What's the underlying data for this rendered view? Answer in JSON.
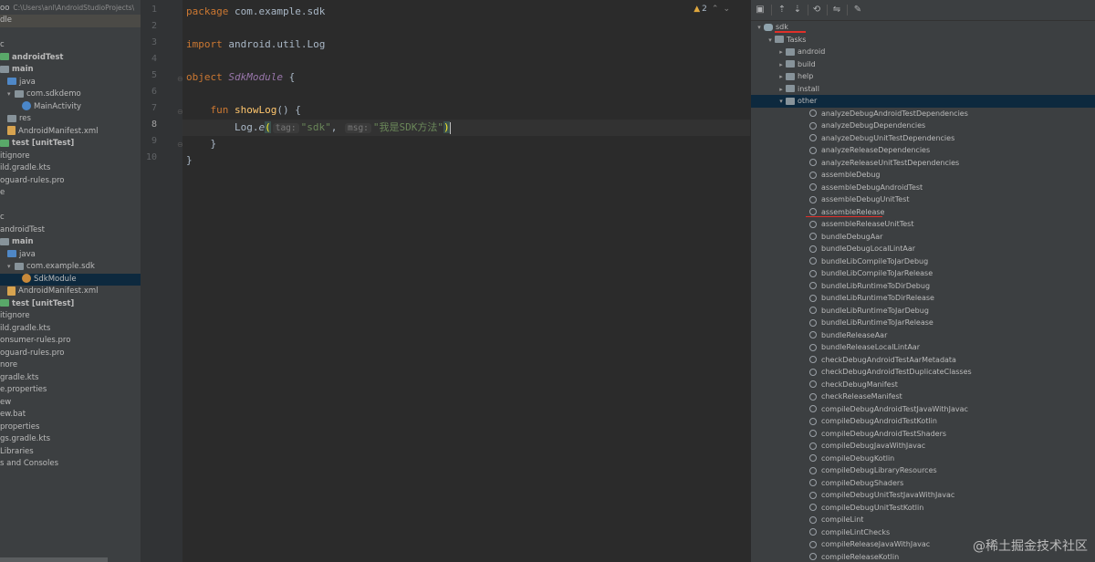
{
  "project_panel": {
    "header": {
      "name": "oo",
      "path": "C:\\Users\\anl\\AndroidStudioProjects\\"
    },
    "rows": [
      {
        "text": "dle",
        "indent": 0,
        "icon": "",
        "bold": false,
        "arrow": ""
      },
      {
        "text": "",
        "indent": 0,
        "icon": "",
        "bold": false,
        "arrow": ""
      },
      {
        "text": "c",
        "indent": 0,
        "icon": "",
        "bold": false,
        "arrow": ""
      },
      {
        "text": "androidTest",
        "indent": 0,
        "icon": "folder-green",
        "bold": true,
        "arrow": ""
      },
      {
        "text": "main",
        "indent": 0,
        "icon": "folder",
        "bold": true,
        "arrow": ""
      },
      {
        "text": "java",
        "indent": 1,
        "icon": "folder-blue",
        "bold": false,
        "arrow": ""
      },
      {
        "text": "com.sdkdemo",
        "indent": 1,
        "icon": "folder",
        "bold": false,
        "arrow": "down"
      },
      {
        "text": "MainActivity",
        "indent": 3,
        "icon": "kotlin",
        "bold": false,
        "arrow": ""
      },
      {
        "text": "res",
        "indent": 1,
        "icon": "folder",
        "bold": false,
        "arrow": ""
      },
      {
        "text": "AndroidManifest.xml",
        "indent": 1,
        "icon": "xml",
        "bold": false,
        "arrow": ""
      },
      {
        "text": "test [unitTest]",
        "indent": 0,
        "icon": "folder-green",
        "bold": true,
        "arrow": ""
      },
      {
        "text": "itignore",
        "indent": 0,
        "icon": "",
        "bold": false,
        "arrow": ""
      },
      {
        "text": "ild.gradle.kts",
        "indent": 0,
        "icon": "",
        "bold": false,
        "arrow": ""
      },
      {
        "text": "oguard-rules.pro",
        "indent": 0,
        "icon": "",
        "bold": false,
        "arrow": ""
      },
      {
        "text": "e",
        "indent": 0,
        "icon": "",
        "bold": false,
        "arrow": ""
      },
      {
        "text": "",
        "indent": 0,
        "icon": "",
        "bold": false,
        "arrow": ""
      },
      {
        "text": "c",
        "indent": 0,
        "icon": "",
        "bold": false,
        "arrow": ""
      },
      {
        "text": "androidTest",
        "indent": 0,
        "icon": "",
        "bold": false,
        "arrow": ""
      },
      {
        "text": "main",
        "indent": 0,
        "icon": "folder",
        "bold": true,
        "arrow": ""
      },
      {
        "text": "java",
        "indent": 1,
        "icon": "folder-blue",
        "bold": false,
        "arrow": ""
      },
      {
        "text": "com.example.sdk",
        "indent": 1,
        "icon": "folder",
        "bold": false,
        "arrow": "down"
      },
      {
        "text": "SdkModule",
        "indent": 3,
        "icon": "kotlin-orange",
        "bold": false,
        "arrow": ""
      },
      {
        "text": "AndroidManifest.xml",
        "indent": 1,
        "icon": "xml",
        "bold": false,
        "arrow": ""
      },
      {
        "text": "test [unitTest]",
        "indent": 0,
        "icon": "folder-green",
        "bold": true,
        "arrow": ""
      },
      {
        "text": "itignore",
        "indent": 0,
        "icon": "",
        "bold": false,
        "arrow": ""
      },
      {
        "text": "ild.gradle.kts",
        "indent": 0,
        "icon": "",
        "bold": false,
        "arrow": ""
      },
      {
        "text": "onsumer-rules.pro",
        "indent": 0,
        "icon": "",
        "bold": false,
        "arrow": ""
      },
      {
        "text": "oguard-rules.pro",
        "indent": 0,
        "icon": "",
        "bold": false,
        "arrow": ""
      },
      {
        "text": "nore",
        "indent": 0,
        "icon": "",
        "bold": false,
        "arrow": ""
      },
      {
        "text": "gradle.kts",
        "indent": 0,
        "icon": "",
        "bold": false,
        "arrow": ""
      },
      {
        "text": "e.properties",
        "indent": 0,
        "icon": "",
        "bold": false,
        "arrow": ""
      },
      {
        "text": "ew",
        "indent": 0,
        "icon": "",
        "bold": false,
        "arrow": ""
      },
      {
        "text": "ew.bat",
        "indent": 0,
        "icon": "",
        "bold": false,
        "arrow": ""
      },
      {
        "text": "properties",
        "indent": 0,
        "icon": "",
        "bold": false,
        "arrow": ""
      },
      {
        "text": "gs.gradle.kts",
        "indent": 0,
        "icon": "",
        "bold": false,
        "arrow": ""
      },
      {
        "text": "Libraries",
        "indent": 0,
        "icon": "",
        "bold": false,
        "arrow": ""
      },
      {
        "text": "s and Consoles",
        "indent": 0,
        "icon": "",
        "bold": false,
        "arrow": ""
      }
    ],
    "selected_index": 21
  },
  "editor": {
    "line_numbers": [
      "1",
      "2",
      "3",
      "4",
      "5",
      "6",
      "7",
      "8",
      "9",
      "10"
    ],
    "current_line": 8,
    "warning_count": "2",
    "lines": {
      "l1_kw": "package",
      "l1_rest": " com.example.sdk",
      "l3_kw": "import",
      "l3_rest": " android.util.Log",
      "l5_kw": "object",
      "l5_name": " SdkModule",
      "l5_rest": " {",
      "l7_indent": "    ",
      "l7_kw": "fun",
      "l7_name": " showLog",
      "l7_rest": "() {",
      "l8_indent": "        ",
      "l8_obj": "Log.",
      "l8_fn": "e",
      "l8_paren": "(",
      "l8_hint1": "tag:",
      "l8_str1": "\"sdk\"",
      "l8_comma": ",",
      "l8_hint2": "msg:",
      "l8_str2": "\"我是SDK方法\"",
      "l8_close": ")",
      "l9": "    }",
      "l10": "}"
    }
  },
  "gradle": {
    "rows": [
      {
        "text": "sdk",
        "level": 1,
        "type": "elephant",
        "arrow": "down"
      },
      {
        "text": "Tasks",
        "level": 2,
        "type": "folder",
        "arrow": "down"
      },
      {
        "text": "android",
        "level": 3,
        "type": "folder",
        "arrow": "right"
      },
      {
        "text": "build",
        "level": 3,
        "type": "folder",
        "arrow": "right"
      },
      {
        "text": "help",
        "level": 3,
        "type": "folder",
        "arrow": "right"
      },
      {
        "text": "install",
        "level": 3,
        "type": "folder",
        "arrow": "right"
      },
      {
        "text": "other",
        "level": 3,
        "type": "folder",
        "arrow": "down"
      },
      {
        "text": "analyzeDebugAndroidTestDependencies",
        "level": 5,
        "type": "task",
        "arrow": ""
      },
      {
        "text": "analyzeDebugDependencies",
        "level": 5,
        "type": "task",
        "arrow": ""
      },
      {
        "text": "analyzeDebugUnitTestDependencies",
        "level": 5,
        "type": "task",
        "arrow": ""
      },
      {
        "text": "analyzeReleaseDependencies",
        "level": 5,
        "type": "task",
        "arrow": ""
      },
      {
        "text": "analyzeReleaseUnitTestDependencies",
        "level": 5,
        "type": "task",
        "arrow": ""
      },
      {
        "text": "assembleDebug",
        "level": 5,
        "type": "task",
        "arrow": ""
      },
      {
        "text": "assembleDebugAndroidTest",
        "level": 5,
        "type": "task",
        "arrow": ""
      },
      {
        "text": "assembleDebugUnitTest",
        "level": 5,
        "type": "task",
        "arrow": ""
      },
      {
        "text": "assembleRelease",
        "level": 5,
        "type": "task",
        "arrow": ""
      },
      {
        "text": "assembleReleaseUnitTest",
        "level": 5,
        "type": "task",
        "arrow": ""
      },
      {
        "text": "bundleDebugAar",
        "level": 5,
        "type": "task",
        "arrow": ""
      },
      {
        "text": "bundleDebugLocalLintAar",
        "level": 5,
        "type": "task",
        "arrow": ""
      },
      {
        "text": "bundleLibCompileToJarDebug",
        "level": 5,
        "type": "task",
        "arrow": ""
      },
      {
        "text": "bundleLibCompileToJarRelease",
        "level": 5,
        "type": "task",
        "arrow": ""
      },
      {
        "text": "bundleLibRuntimeToDirDebug",
        "level": 5,
        "type": "task",
        "arrow": ""
      },
      {
        "text": "bundleLibRuntimeToDirRelease",
        "level": 5,
        "type": "task",
        "arrow": ""
      },
      {
        "text": "bundleLibRuntimeToJarDebug",
        "level": 5,
        "type": "task",
        "arrow": ""
      },
      {
        "text": "bundleLibRuntimeToJarRelease",
        "level": 5,
        "type": "task",
        "arrow": ""
      },
      {
        "text": "bundleReleaseAar",
        "level": 5,
        "type": "task",
        "arrow": ""
      },
      {
        "text": "bundleReleaseLocalLintAar",
        "level": 5,
        "type": "task",
        "arrow": ""
      },
      {
        "text": "checkDebugAndroidTestAarMetadata",
        "level": 5,
        "type": "task",
        "arrow": ""
      },
      {
        "text": "checkDebugAndroidTestDuplicateClasses",
        "level": 5,
        "type": "task",
        "arrow": ""
      },
      {
        "text": "checkDebugManifest",
        "level": 5,
        "type": "task",
        "arrow": ""
      },
      {
        "text": "checkReleaseManifest",
        "level": 5,
        "type": "task",
        "arrow": ""
      },
      {
        "text": "compileDebugAndroidTestJavaWithJavac",
        "level": 5,
        "type": "task",
        "arrow": ""
      },
      {
        "text": "compileDebugAndroidTestKotlin",
        "level": 5,
        "type": "task",
        "arrow": ""
      },
      {
        "text": "compileDebugAndroidTestShaders",
        "level": 5,
        "type": "task",
        "arrow": ""
      },
      {
        "text": "compileDebugJavaWithJavac",
        "level": 5,
        "type": "task",
        "arrow": ""
      },
      {
        "text": "compileDebugKotlin",
        "level": 5,
        "type": "task",
        "arrow": ""
      },
      {
        "text": "compileDebugLibraryResources",
        "level": 5,
        "type": "task",
        "arrow": ""
      },
      {
        "text": "compileDebugShaders",
        "level": 5,
        "type": "task",
        "arrow": ""
      },
      {
        "text": "compileDebugUnitTestJavaWithJavac",
        "level": 5,
        "type": "task",
        "arrow": ""
      },
      {
        "text": "compileDebugUnitTestKotlin",
        "level": 5,
        "type": "task",
        "arrow": ""
      },
      {
        "text": "compileLint",
        "level": 5,
        "type": "task",
        "arrow": ""
      },
      {
        "text": "compileLintChecks",
        "level": 5,
        "type": "task",
        "arrow": ""
      },
      {
        "text": "compileReleaseJavaWithJavac",
        "level": 5,
        "type": "task",
        "arrow": ""
      },
      {
        "text": "compileReleaseKotlin",
        "level": 5,
        "type": "task",
        "arrow": ""
      }
    ],
    "selected_index": 6,
    "underlined": [
      "sdk",
      "assembleRelease"
    ]
  },
  "watermark": "@稀土掘金技术社区",
  "colors": {
    "keyword": "#cc7832",
    "function": "#ffc66d",
    "string": "#6a8759",
    "annotation": "#e0302a",
    "selection": "#0d293e"
  }
}
